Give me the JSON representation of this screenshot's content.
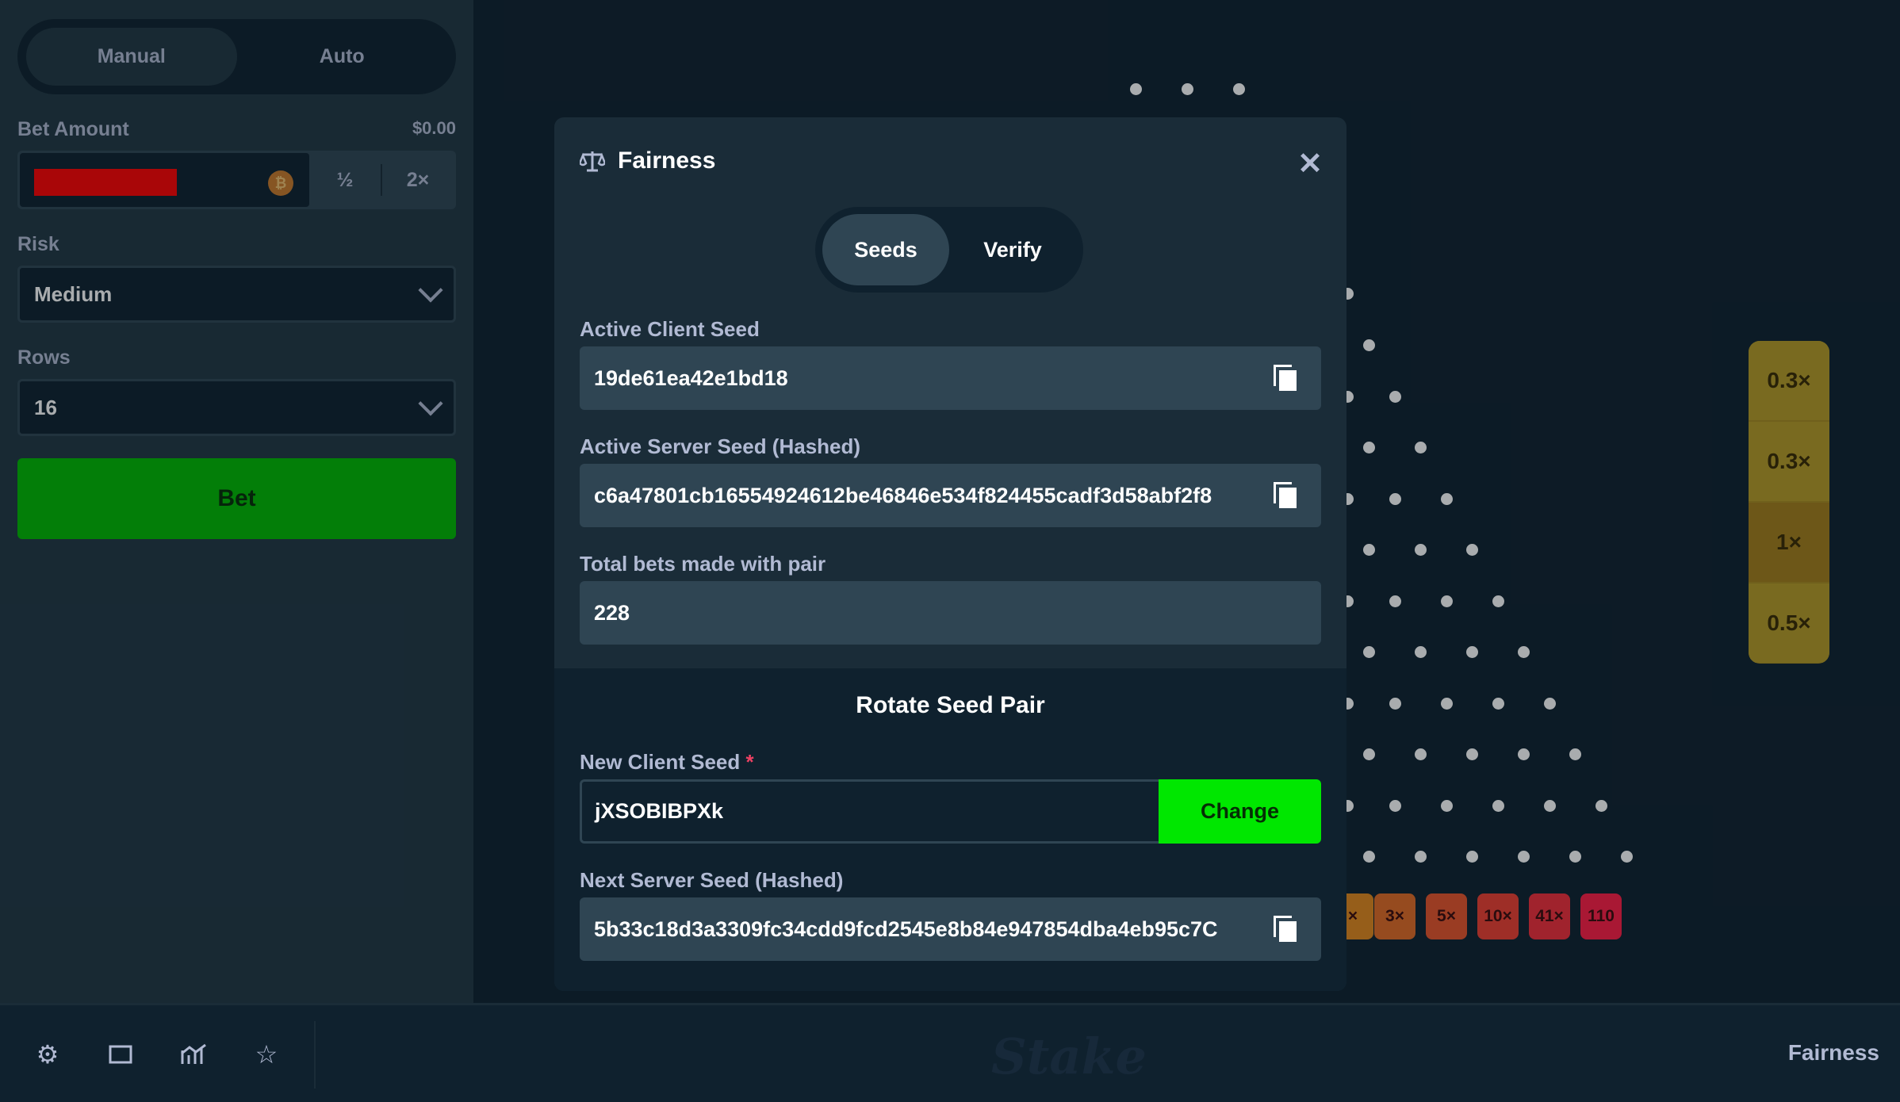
{
  "sidebar": {
    "modes": [
      "Manual",
      "Auto"
    ],
    "bet_amount_label": "Bet Amount",
    "bet_amount_value": "$0.00",
    "half_label": "½",
    "double_label": "2×",
    "risk_label": "Risk",
    "risk_value": "Medium",
    "rows_label": "Rows",
    "rows_value": "16",
    "bet_button": "Bet"
  },
  "history": [
    "0.3×",
    "0.3×",
    "1×",
    "0.5×"
  ],
  "multipliers": [
    "×",
    "3×",
    "5×",
    "10×",
    "41×",
    "110"
  ],
  "modal": {
    "title": "Fairness",
    "close": "✕",
    "tabs": [
      "Seeds",
      "Verify"
    ],
    "active_client_seed_label": "Active Client Seed",
    "active_client_seed": "19de61ea42e1bd18",
    "active_server_seed_label": "Active Server Seed (Hashed)",
    "active_server_seed": "c6a47801cb16554924612be46846e534f824455cadf3d58abf2f8",
    "total_bets_label": "Total bets made with pair",
    "total_bets": "228",
    "rotate_title": "Rotate Seed Pair",
    "new_client_seed_label": "New Client Seed",
    "required_mark": "*",
    "new_client_seed": "jXSOBIBPXk",
    "change_button": "Change",
    "next_server_seed_label": "Next Server Seed (Hashed)",
    "next_server_seed": "5b33c18d3a3309fc34cdd9fcd2545e8b84e947854dba4eb95c7C"
  },
  "bottombar": {
    "logo": "Stake",
    "fairness": "Fairness",
    "icons": [
      "gear-icon",
      "theatre-icon",
      "stats-icon",
      "star-icon"
    ]
  },
  "colors": {
    "bg": "#0f212e",
    "panel": "#213743",
    "input": "#2f4553",
    "bet_green": "#00b800",
    "change_green": "#00e700"
  }
}
